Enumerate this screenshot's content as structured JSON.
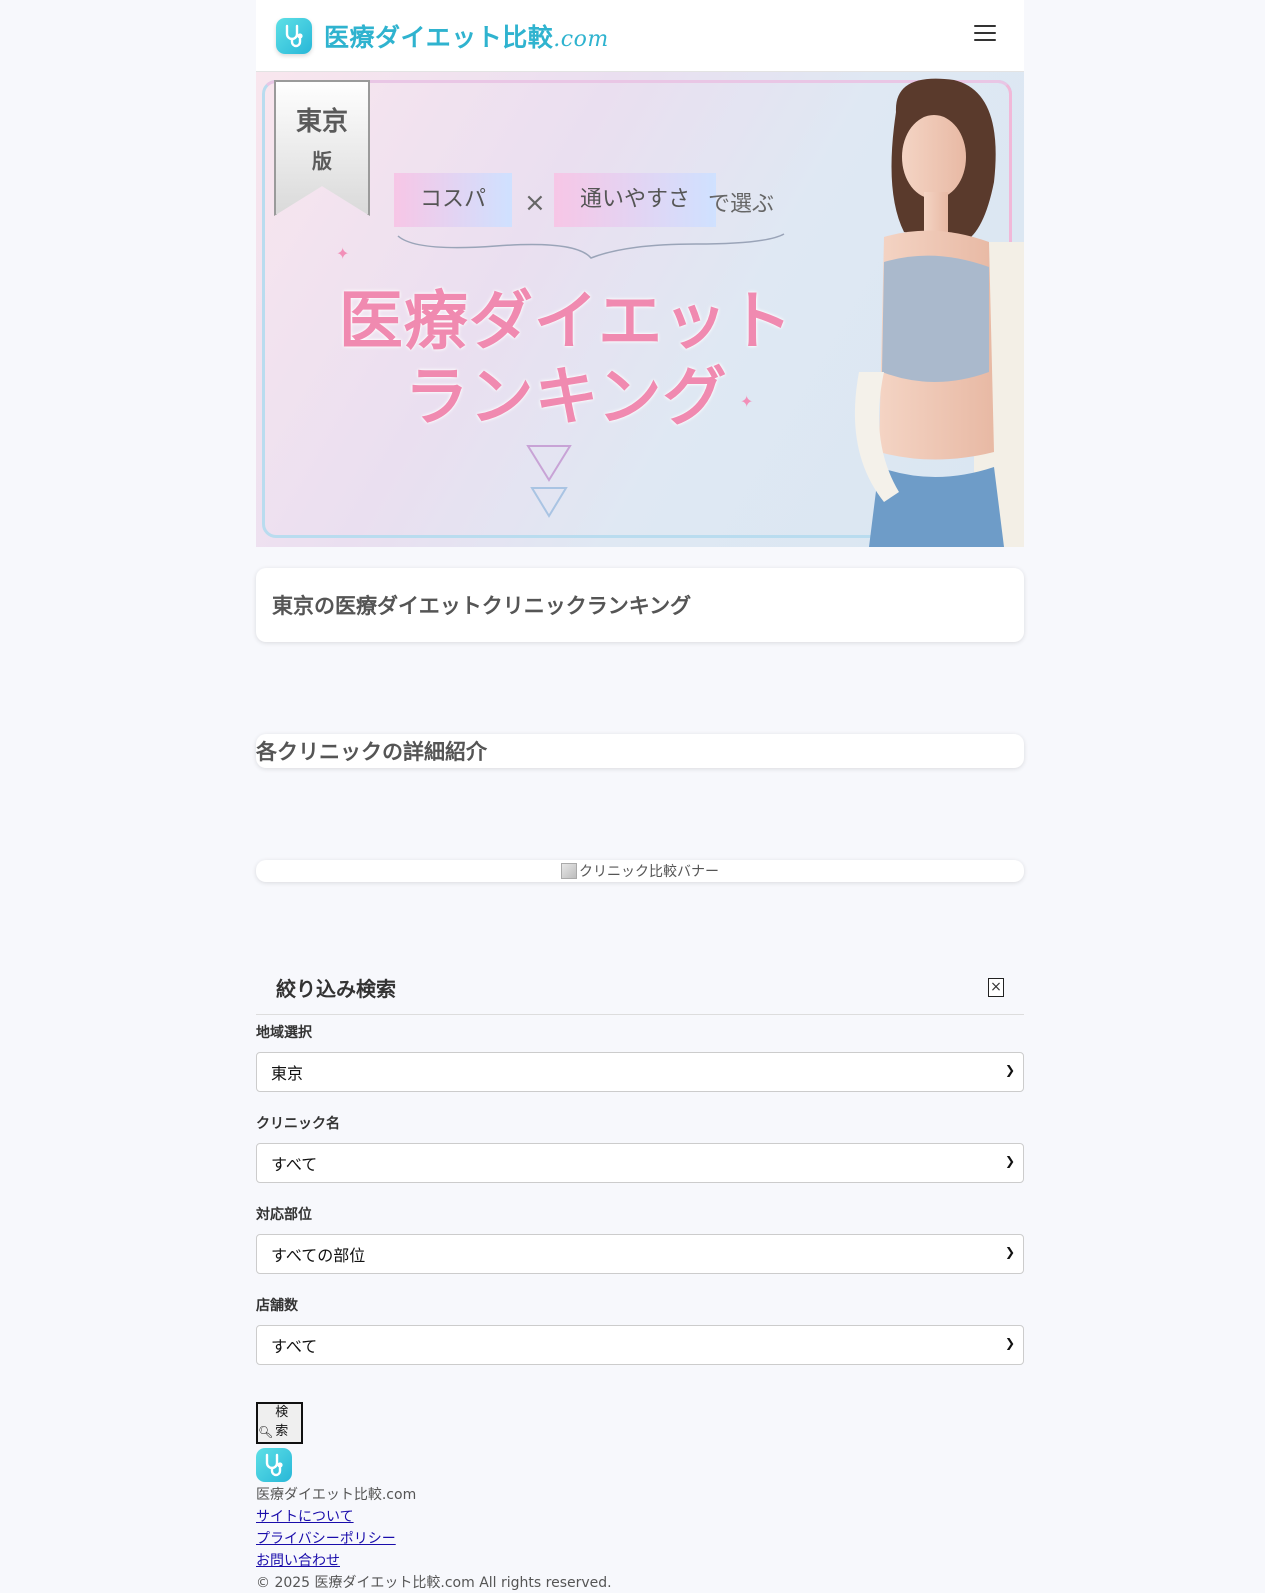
{
  "header": {
    "logo_main": "医療ダイエット比較",
    "logo_suffix": ".com",
    "menu_icon": "hamburger-menu-icon"
  },
  "hero": {
    "ribbon_line1": "東京",
    "ribbon_line2": "版",
    "tag1": "コスパ",
    "times": "×",
    "tag2": "通いやすさ",
    "choose": "で選ぶ",
    "title_line1": "医療ダイエット",
    "title_line2": "ランキング"
  },
  "ranking_title": "東京の医療ダイエットクリニックランキング",
  "details_title": "各クリニックの詳細紹介",
  "banner_alt": "クリニック比較バナー",
  "filter": {
    "title": "絞り込み検索",
    "close": "×",
    "region_label": "地域選択",
    "region_value": "東京",
    "clinic_label": "クリニック名",
    "clinic_value": "すべて",
    "part_label": "対応部位",
    "part_value": "すべての部位",
    "stores_label": "店舗数",
    "stores_value": "すべて",
    "search_label": "検索"
  },
  "footer": {
    "site_name": "医療ダイエット比較.com",
    "links": [
      "サイトについて",
      "プライバシーポリシー",
      "お問い合わせ"
    ],
    "copyright": "© 2025 医療ダイエット比較.com All rights reserved."
  },
  "colors": {
    "brand": "#2fb3cf",
    "hero_title": "#f08ab0",
    "background": "#f7f8fc"
  }
}
